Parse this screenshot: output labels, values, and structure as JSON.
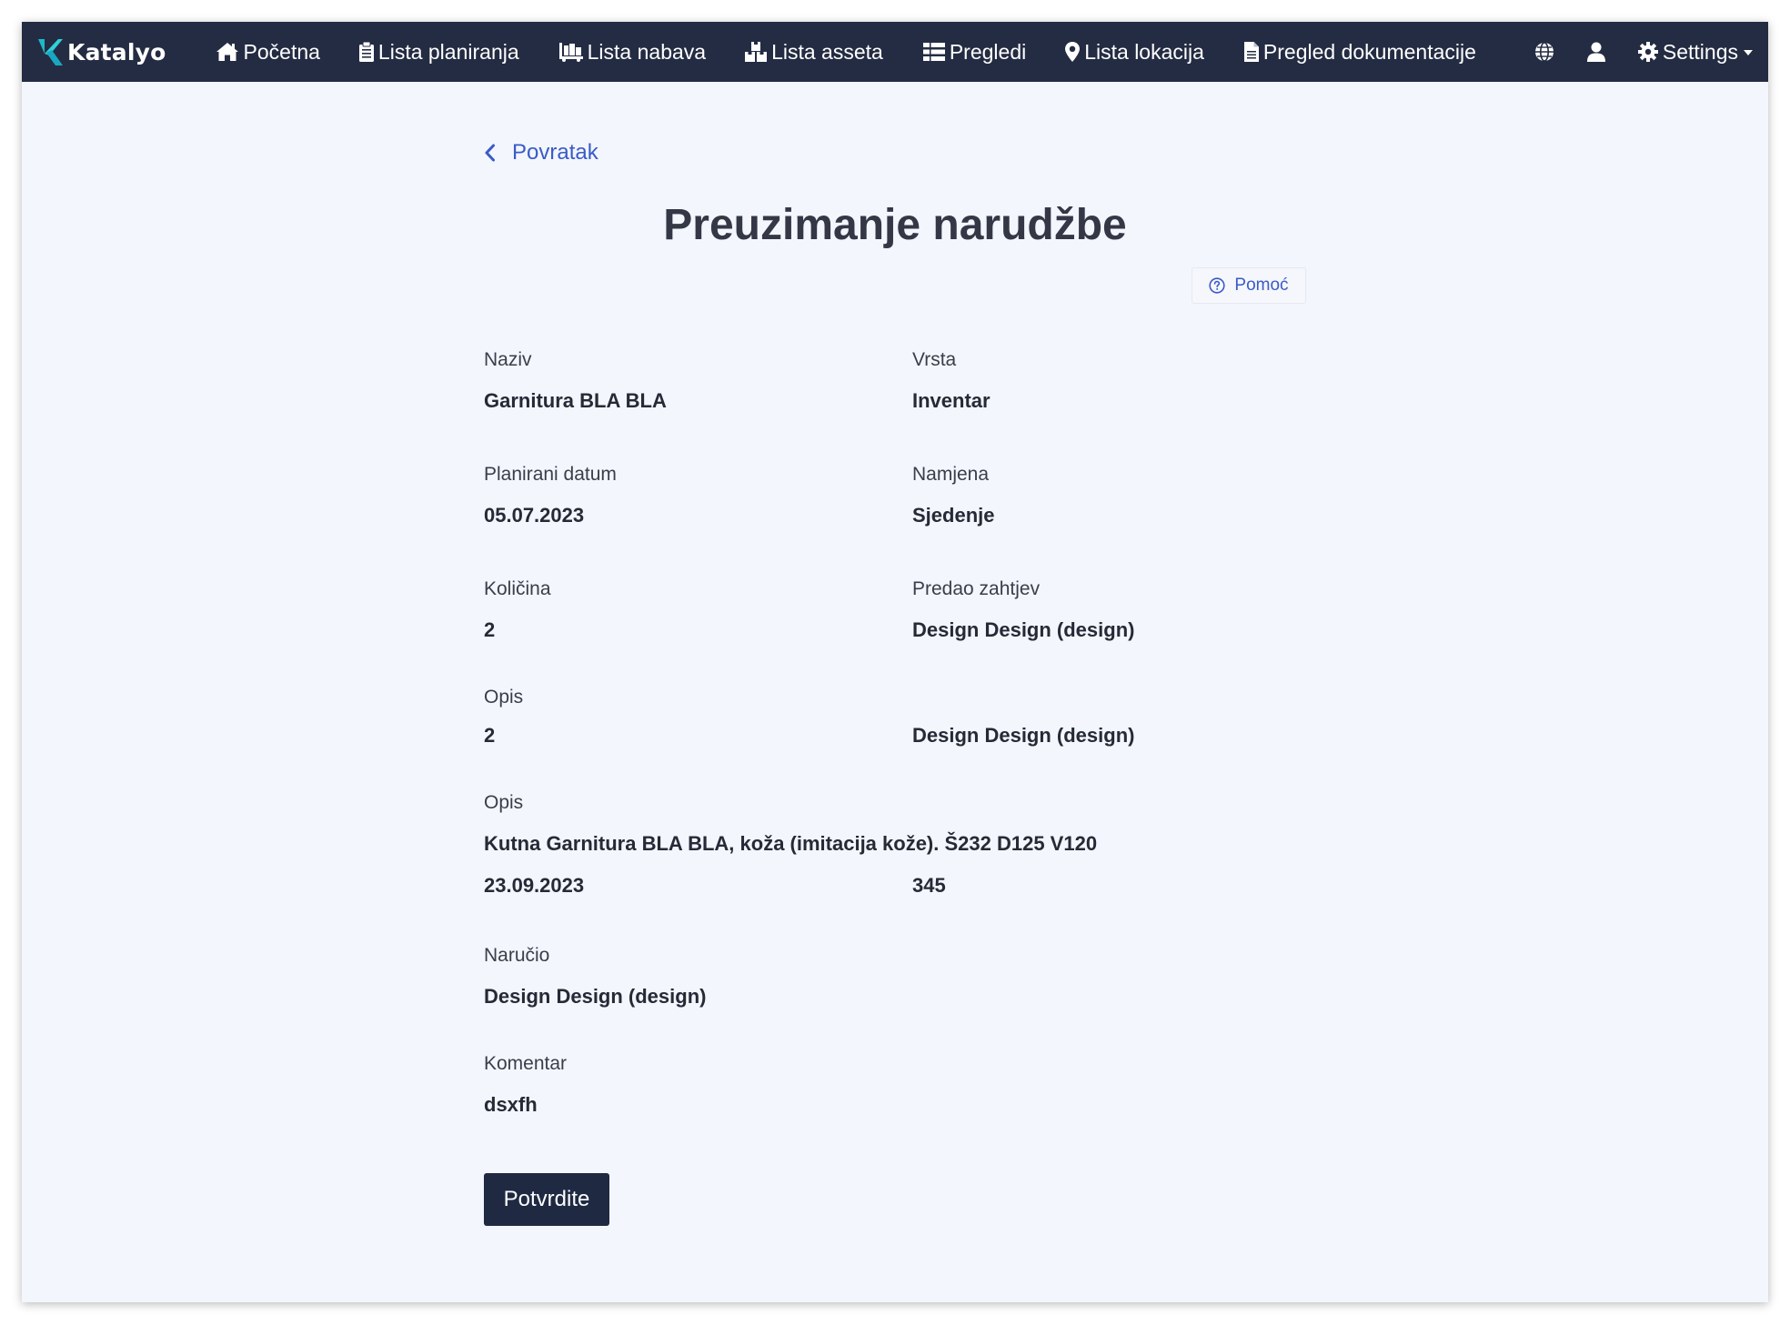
{
  "navbar": {
    "brand": "Katalyo",
    "items": [
      {
        "label": "Početna",
        "icon": "home-icon"
      },
      {
        "label": "Lista planiranja",
        "icon": "clipboard-icon"
      },
      {
        "label": "Lista nabava",
        "icon": "dolly-icon"
      },
      {
        "label": "Lista asseta",
        "icon": "boxes-icon"
      },
      {
        "label": "Pregledi",
        "icon": "table-icon"
      },
      {
        "label": "Lista lokacija",
        "icon": "map-marker-icon"
      },
      {
        "label": "Pregled dokumentacije",
        "icon": "file-icon"
      }
    ],
    "language_icon": "globe-icon",
    "user_icon": "user-icon",
    "settings": {
      "label": "Settings",
      "icon": "gear-icon"
    }
  },
  "back": {
    "label": "Povratak",
    "icon": "chevron-left-icon"
  },
  "title": "Preuzimanje narudžbe",
  "help": {
    "label": "Pomoć",
    "icon": "question-circle-icon"
  },
  "fields": {
    "naziv": {
      "label": "Naziv",
      "value": "Garnitura BLA BLA"
    },
    "vrsta": {
      "label": "Vrsta",
      "value": "Inventar"
    },
    "planirani_datum": {
      "label": "Planirani datum",
      "value": "05.07.2023"
    },
    "namjena": {
      "label": "Namjena",
      "value": "Sjedenje"
    },
    "kolicina": {
      "label": "Količina",
      "value": "2"
    },
    "predao_zahtjev": {
      "label": "Predao zahtjev",
      "value": "Design Design (design)"
    },
    "opis_row": {
      "label": "Opis",
      "value_left": "2",
      "value_right": "Design Design (design)"
    },
    "opis": {
      "label": "Opis",
      "value": "Kutna Garnitura BLA BLA, koža (imitacija kože). Š232 D125 V120",
      "extra_left": "23.09.2023",
      "extra_right": "345"
    },
    "narucio": {
      "label": "Naručio",
      "value": "Design Design (design)"
    },
    "komentar": {
      "label": "Komentar",
      "value": "dsxfh"
    }
  },
  "confirm_button": "Potvrdite",
  "colors": {
    "navbar_bg": "#242c43",
    "page_bg": "#f3f6fc",
    "link": "#3a5bc7",
    "brand_accent": "#1fb8c9",
    "button_bg": "#1f2942"
  }
}
